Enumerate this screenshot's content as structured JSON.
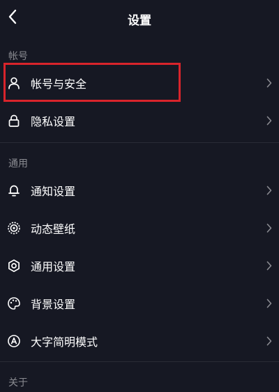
{
  "header": {
    "title": "设置",
    "back_icon": "chevron-left-icon"
  },
  "sections": {
    "account": {
      "label": "帐号",
      "items": [
        {
          "label": "帐号与安全",
          "icon": "user-icon"
        },
        {
          "label": "隐私设置",
          "icon": "lock-icon"
        }
      ]
    },
    "general": {
      "label": "通用",
      "items": [
        {
          "label": "通知设置",
          "icon": "bell-icon"
        },
        {
          "label": "动态壁纸",
          "icon": "dynamic-wallpaper-icon"
        },
        {
          "label": "通用设置",
          "icon": "gear-icon"
        },
        {
          "label": "背景设置",
          "icon": "palette-icon"
        },
        {
          "label": "大字简明模式",
          "icon": "large-font-icon"
        }
      ]
    },
    "about": {
      "label": "关于"
    }
  },
  "colors": {
    "background": "#161823",
    "text": "#ffffff",
    "section_label": "#8a8b91",
    "chevron": "#8a8b91",
    "highlight": "#d9242b"
  }
}
